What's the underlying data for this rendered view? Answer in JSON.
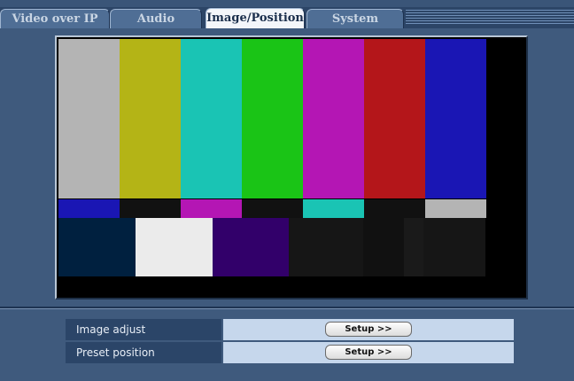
{
  "tabs": [
    {
      "label": "Video over IP",
      "active": false
    },
    {
      "label": "Audio",
      "active": false
    },
    {
      "label": "Image/Position",
      "active": true
    },
    {
      "label": "System",
      "active": false
    }
  ],
  "colors": {
    "top_bars": [
      "#b4b4b4",
      "#b4b416",
      "#1ac4b4",
      "#1ac416",
      "#b416b4",
      "#b4161a",
      "#1a16b4"
    ],
    "mid_bars": [
      "#1a16b4",
      "#111111",
      "#b416b4",
      "#111111",
      "#1ac4b4",
      "#111111",
      "#b4b4b4"
    ],
    "bottom_blocks": [
      "#00203f",
      "#ebebeb",
      "#32006a",
      "#161616",
      "#111111",
      "#111111",
      "#1a1a1a",
      "#161616"
    ]
  },
  "settings": [
    {
      "label": "Image adjust",
      "button": "Setup >>"
    },
    {
      "label": "Preset position",
      "button": "Setup >>"
    }
  ]
}
